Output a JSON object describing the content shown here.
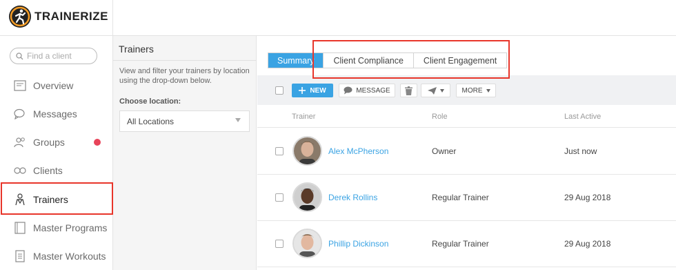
{
  "app": {
    "logo_text": "TRAINERIZE"
  },
  "sidebar": {
    "search_placeholder": "Find a client",
    "items": [
      {
        "label": "Overview",
        "icon": "overview-icon"
      },
      {
        "label": "Messages",
        "icon": "messages-icon"
      },
      {
        "label": "Groups",
        "icon": "groups-icon",
        "badge_color": "#e8445a"
      },
      {
        "label": "Clients",
        "icon": "clients-icon"
      },
      {
        "label": "Trainers",
        "icon": "trainers-icon",
        "active": true
      },
      {
        "label": "Master Programs",
        "icon": "programs-icon"
      },
      {
        "label": "Master Workouts",
        "icon": "workouts-icon"
      }
    ]
  },
  "panel": {
    "title": "Trainers",
    "description": "View and filter your trainers by location using the drop-down below.",
    "location_label": "Choose location:",
    "location_value": "All Locations"
  },
  "main": {
    "tabs": [
      {
        "label": "Summary",
        "active": true
      },
      {
        "label": "Client Compliance"
      },
      {
        "label": "Client Engagement"
      }
    ],
    "toolbar": {
      "new_label": "NEW",
      "message_label": "MESSAGE",
      "more_label": "MORE"
    },
    "columns": [
      "Trainer",
      "Role",
      "Last Active"
    ],
    "rows": [
      {
        "name": "Alex McPherson",
        "role": "Owner",
        "last_active": "Just now"
      },
      {
        "name": "Derek Rollins",
        "role": "Regular Trainer",
        "last_active": "29 Aug 2018"
      },
      {
        "name": "Phillip Dickinson",
        "role": "Regular Trainer",
        "last_active": "29 Aug 2018"
      }
    ]
  },
  "colors": {
    "accent": "#3aa3e3",
    "highlight": "#e8352a",
    "badge": "#e8445a"
  }
}
